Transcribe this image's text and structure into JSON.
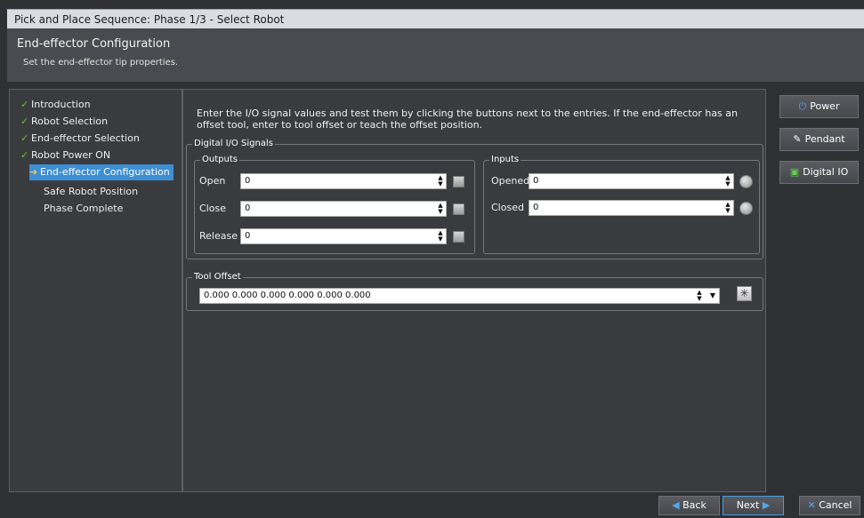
{
  "window": {
    "title": "Pick and Place Sequence: Phase 1/3 - Select Robot"
  },
  "header": {
    "title": "End-effector Configuration",
    "subtitle": "Set the end-effector tip properties."
  },
  "steps": [
    {
      "label": "Introduction",
      "status": "done"
    },
    {
      "label": "Robot Selection",
      "status": "done"
    },
    {
      "label": "End-effector Selection",
      "status": "done"
    },
    {
      "label": "Robot Power ON",
      "status": "done"
    },
    {
      "label": "End-effector Configuration",
      "status": "current"
    },
    {
      "label": "Safe Robot Position",
      "status": "pending"
    },
    {
      "label": "Phase Complete",
      "status": "pending"
    }
  ],
  "instructions": "Enter the I/O signal values and test them by clicking the buttons next to the entries. If the end-effector has an offset tool, enter to tool offset or teach the offset position.",
  "digital_io": {
    "title": "Digital I/O Signals",
    "outputs": {
      "title": "Outputs",
      "rows": [
        {
          "label": "Open",
          "value": "0"
        },
        {
          "label": "Close",
          "value": "0"
        },
        {
          "label": "Release",
          "value": "0"
        }
      ]
    },
    "inputs": {
      "title": "Inputs",
      "rows": [
        {
          "label": "Opened",
          "value": "0"
        },
        {
          "label": "Closed",
          "value": "0"
        }
      ]
    }
  },
  "tool_offset": {
    "title": "Tool Offset",
    "value": "0.000 0.000 0.000 0.000 0.000 0.000"
  },
  "side_buttons": {
    "power": "Power",
    "pendant": "Pendant",
    "digital_io": "Digital IO"
  },
  "footer": {
    "back": "Back",
    "next": "Next",
    "cancel": "Cancel"
  },
  "colors": {
    "accent": "#3d8fd4",
    "done_check": "#6fbf3a",
    "panel": "#3a3b3f"
  }
}
